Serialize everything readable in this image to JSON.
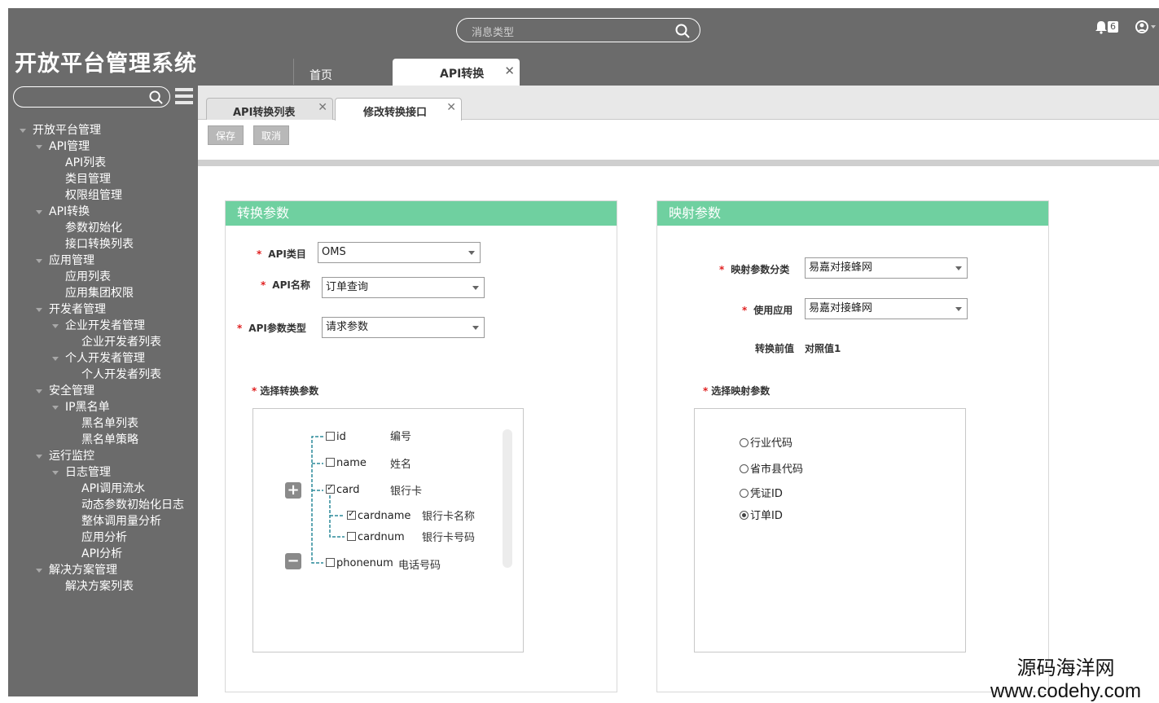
{
  "app": {
    "title": "开放平台管理系统"
  },
  "header": {
    "search_placeholder": "消息类型",
    "notification_count": "6",
    "tabs": [
      {
        "label": "首页"
      },
      {
        "label": "API转换"
      }
    ]
  },
  "sidebar": {
    "items": [
      {
        "label": "开放平台管理",
        "level": 0,
        "expanded": true
      },
      {
        "label": "API管理",
        "level": 1,
        "expanded": true
      },
      {
        "label": "API列表",
        "level": 2
      },
      {
        "label": "类目管理",
        "level": 2
      },
      {
        "label": "权限组管理",
        "level": 2
      },
      {
        "label": "API转换",
        "level": 1,
        "expanded": true
      },
      {
        "label": "参数初始化",
        "level": 2
      },
      {
        "label": "接口转换列表",
        "level": 2
      },
      {
        "label": "应用管理",
        "level": 1,
        "expanded": true
      },
      {
        "label": "应用列表",
        "level": 2
      },
      {
        "label": "应用集团权限",
        "level": 2
      },
      {
        "label": "开发者管理",
        "level": 1,
        "expanded": true
      },
      {
        "label": "企业开发者管理",
        "level": 2,
        "expanded": true
      },
      {
        "label": "企业开发者列表",
        "level": 3
      },
      {
        "label": "个人开发者管理",
        "level": 2,
        "expanded": true
      },
      {
        "label": "个人开发者列表",
        "level": 3
      },
      {
        "label": "安全管理",
        "level": 1,
        "expanded": true
      },
      {
        "label": "IP黑名单",
        "level": 2,
        "expanded": true
      },
      {
        "label": "黑名单列表",
        "level": 3
      },
      {
        "label": "黑名单策略",
        "level": 3
      },
      {
        "label": "运行监控",
        "level": 1,
        "expanded": true
      },
      {
        "label": "日志管理",
        "level": 2,
        "expanded": true
      },
      {
        "label": "API调用流水",
        "level": 3
      },
      {
        "label": "动态参数初始化日志",
        "level": 3
      },
      {
        "label": "整体调用量分析",
        "level": 3
      },
      {
        "label": "应用分析",
        "level": 3
      },
      {
        "label": "API分析",
        "level": 3
      },
      {
        "label": "解决方案管理",
        "level": 1,
        "expanded": true
      },
      {
        "label": "解决方案列表",
        "level": 2
      }
    ]
  },
  "subtabs": [
    {
      "label": "API转换列表"
    },
    {
      "label": "修改转换接口"
    }
  ],
  "toolbar": {
    "save_label": "保存",
    "cancel_label": "取消"
  },
  "left_panel": {
    "title": "转换参数",
    "fields": {
      "api_category": {
        "label": "API类目",
        "value": "OMS"
      },
      "api_name": {
        "label": "API名称",
        "value": "订单查询"
      },
      "api_param_type": {
        "label": "API参数类型",
        "value": "请求参数"
      }
    },
    "select_params_label": "选择转换参数",
    "tree": [
      {
        "key": "id",
        "desc": "编号",
        "checked": false
      },
      {
        "key": "name",
        "desc": "姓名",
        "checked": false
      },
      {
        "key": "card",
        "desc": "银行卡",
        "checked": true
      },
      {
        "key": "cardname",
        "desc": "银行卡名称",
        "checked": true
      },
      {
        "key": "cardnum",
        "desc": "银行卡号码",
        "checked": false
      },
      {
        "key": "phonenum",
        "desc": "电话号码",
        "checked": false
      }
    ]
  },
  "right_panel": {
    "title": "映射参数",
    "fields": {
      "mapping_category": {
        "label": "映射参数分类",
        "value": "易嘉对接蜂网"
      },
      "use_app": {
        "label": "使用应用",
        "value": "易嘉对接蜂网"
      },
      "pre_value": {
        "label": "转换前值",
        "value": "对照值1"
      }
    },
    "select_params_label": "选择映射参数",
    "options": [
      {
        "label": "行业代码",
        "selected": false
      },
      {
        "label": "省市县代码",
        "selected": false
      },
      {
        "label": "凭证ID",
        "selected": false
      },
      {
        "label": "订单ID",
        "selected": true
      }
    ]
  },
  "watermark": {
    "line1": "源码海洋网",
    "line2": "www.codehy.com"
  }
}
